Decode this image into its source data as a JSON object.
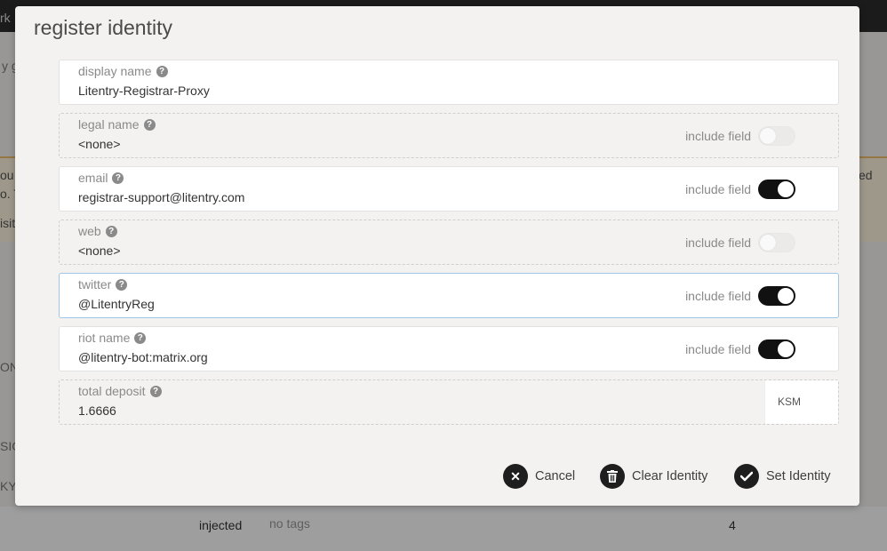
{
  "background": {
    "topbar_text": "rk",
    "snippets": [
      "y go",
      "ou",
      "o. T",
      "isit",
      "ed",
      "ON",
      "SIG",
      "KY"
    ],
    "row": {
      "type": "injected",
      "tags": "no tags",
      "count": "4"
    }
  },
  "modal": {
    "title": "register identity",
    "include_label": "include field",
    "fields": [
      {
        "label": "display name",
        "value": "Litentry-Registrar-Proxy"
      },
      {
        "label": "legal name",
        "value": "<none>",
        "include": false
      },
      {
        "label": "email",
        "value": "registrar-support@litentry.com",
        "include": true
      },
      {
        "label": "web",
        "value": "<none>",
        "include": false
      },
      {
        "label": "twitter",
        "value": "@LitentryReg",
        "include": true
      },
      {
        "label": "riot name",
        "value": "@litentry-bot:matrix.org",
        "include": true
      }
    ],
    "deposit": {
      "label": "total deposit",
      "value": "1.6666",
      "unit": "KSM"
    },
    "actions": {
      "cancel": "Cancel",
      "clear": "Clear Identity",
      "set": "Set Identity"
    }
  }
}
